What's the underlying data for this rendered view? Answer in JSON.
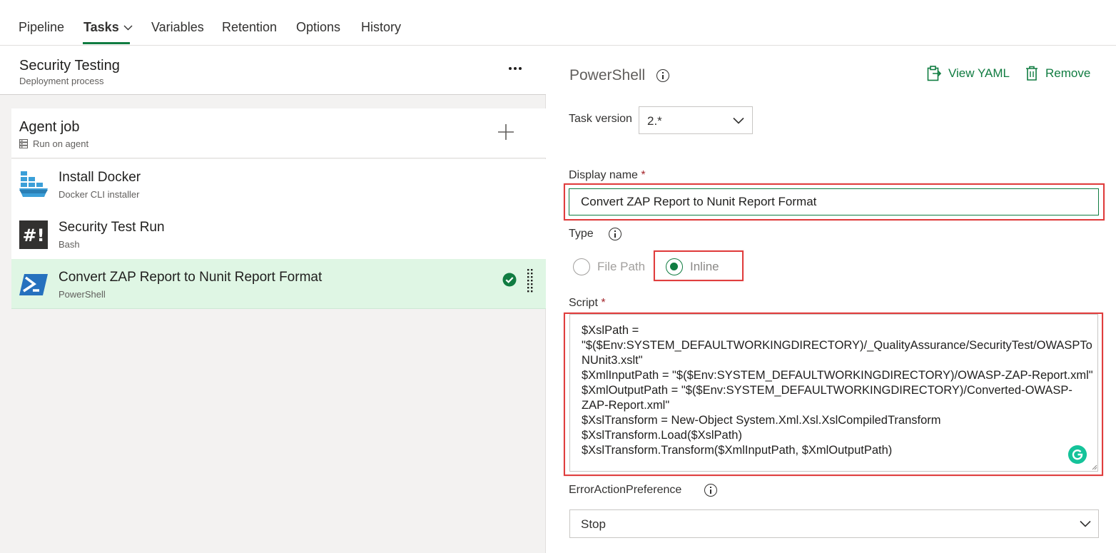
{
  "tabs": [
    {
      "label": "Pipeline"
    },
    {
      "label": "Tasks"
    },
    {
      "label": "Variables"
    },
    {
      "label": "Retention"
    },
    {
      "label": "Options"
    },
    {
      "label": "History"
    }
  ],
  "stage": {
    "title": "Security Testing",
    "subtitle": "Deployment process"
  },
  "job": {
    "title": "Agent job",
    "subtitle": "Run on agent"
  },
  "tasks": [
    {
      "title": "Install Docker",
      "subtitle": "Docker CLI installer",
      "icon": "docker-icon"
    },
    {
      "title": "Security Test Run",
      "subtitle": "Bash",
      "icon": "bash-icon"
    },
    {
      "title": "Convert ZAP Report to Nunit Report Format",
      "subtitle": "PowerShell",
      "icon": "powershell-icon",
      "selected": true
    }
  ],
  "panel": {
    "title": "PowerShell",
    "view_yaml": "View YAML",
    "remove": "Remove",
    "task_version_label": "Task version",
    "task_version_value": "2.*",
    "display_name_label": "Display name",
    "display_name_value": "Convert ZAP Report to Nunit Report Format",
    "required_mark": "*",
    "type_label": "Type",
    "type_options": [
      "File Path",
      "Inline"
    ],
    "type_selected": "Inline",
    "script_label": "Script",
    "script_lines": [
      "$XslPath =",
      "\"$($Env:SYSTEM_DEFAULTWORKINGDIRECTORY)/_QualityAssurance/SecurityTest/OWASPTo",
      "NUnit3.xslt\"",
      "$XmlInputPath = \"$($Env:SYSTEM_DEFAULTWORKINGDIRECTORY)/OWASP-ZAP-Report.xml\"",
      "$XmlOutputPath = \"$($Env:SYSTEM_DEFAULTWORKINGDIRECTORY)/Converted-OWASP-",
      "ZAP-Report.xml\"",
      "$XslTransform = New-Object System.Xml.Xsl.XslCompiledTransform",
      "$XslTransform.Load($XslPath)",
      "$XslTransform.Transform($XmlInputPath, $XmlOutputPath)"
    ],
    "error_action_label": "ErrorActionPreference",
    "error_action_value": "Stop"
  },
  "colors": {
    "accent": "#107c41",
    "selected_row": "#dff6e4",
    "highlight": "#e03e3e",
    "required": "#a4262c"
  }
}
